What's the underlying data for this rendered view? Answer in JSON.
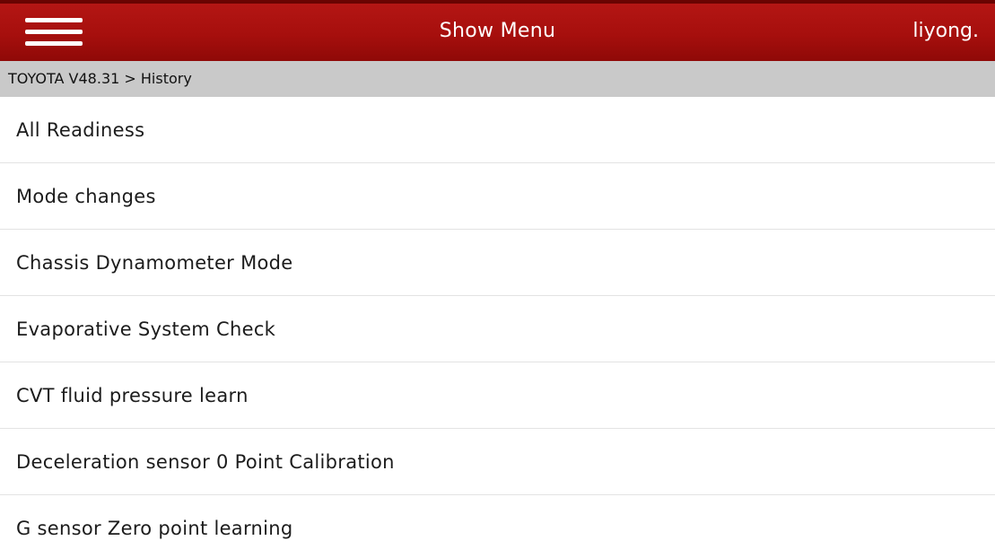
{
  "header": {
    "title": "Show Menu",
    "user": "liyong.",
    "menu_icon": "hamburger-menu-icon",
    "background_color": "#a60f0d"
  },
  "breadcrumb": {
    "text": "TOYOTA V48.31 > History",
    "background_color": "#c9c9c9"
  },
  "list": {
    "items": [
      {
        "label": "All Readiness"
      },
      {
        "label": "Mode changes"
      },
      {
        "label": "Chassis Dynamometer Mode"
      },
      {
        "label": "Evaporative System Check"
      },
      {
        "label": "CVT fluid pressure learn"
      },
      {
        "label": "Deceleration sensor 0 Point Calibration"
      },
      {
        "label": "G sensor Zero point learning"
      }
    ]
  }
}
